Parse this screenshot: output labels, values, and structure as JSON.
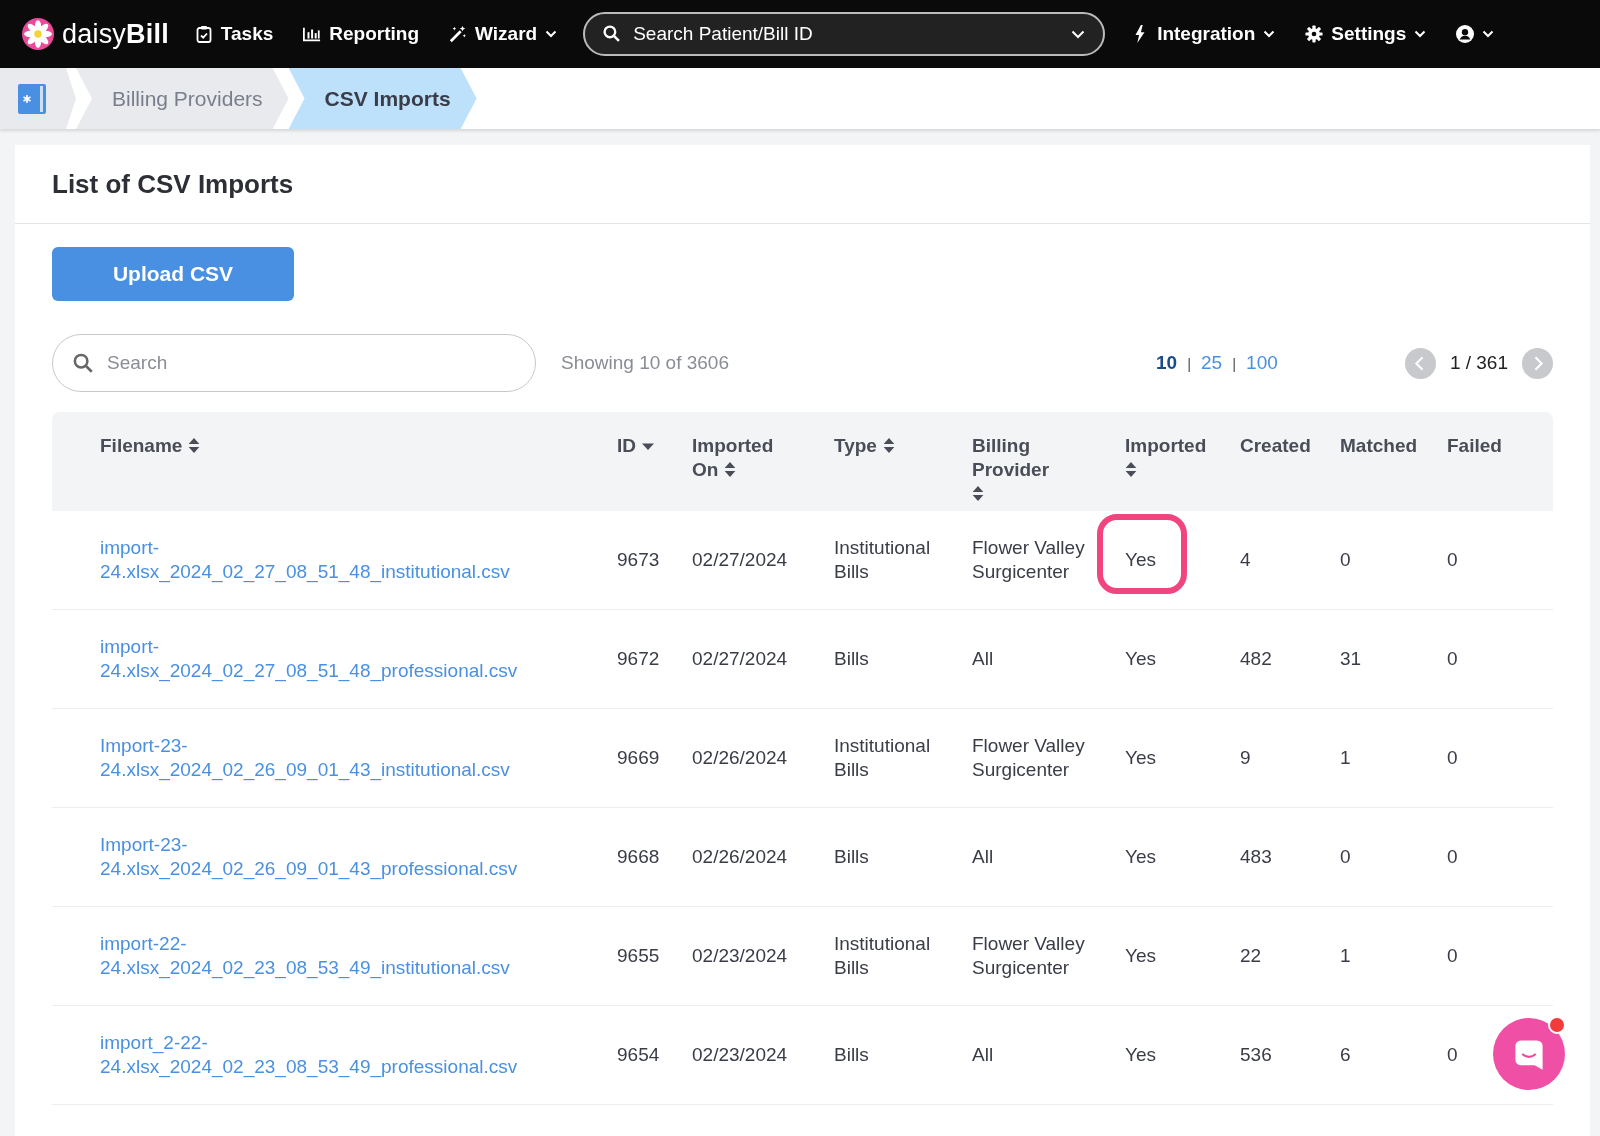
{
  "nav": {
    "logo": "daisy",
    "logo_bold": "Bill",
    "items": [
      {
        "label": "Tasks",
        "caret": false
      },
      {
        "label": "Reporting",
        "caret": false
      },
      {
        "label": "Wizard",
        "caret": true
      }
    ],
    "search": {
      "placeholder": "Search Patient/Bill ID"
    },
    "right_items": [
      {
        "label": "Integration",
        "caret": true
      },
      {
        "label": "Settings",
        "caret": true
      },
      {
        "caret": true
      }
    ]
  },
  "breadcrumbs": [
    {
      "label": "Billing Providers",
      "selected": false
    },
    {
      "label": "CSV Imports",
      "selected": true
    }
  ],
  "page": {
    "title": "List of CSV Imports",
    "upload_button": "Upload CSV",
    "search": {
      "placeholder": "Search"
    },
    "showing": "Showing 10 of 3606",
    "page_sizes": [
      {
        "label": "10",
        "selected": true
      },
      {
        "separator": "|",
        "label": "25",
        "selected": false
      },
      {
        "separator": "|",
        "label": "100",
        "selected": false
      }
    ],
    "pagination": "1 / 361"
  },
  "table": {
    "columns": [
      {
        "label": "Filename",
        "sortable": true,
        "sorted_desc": false
      },
      {
        "label": "ID",
        "sortable": true,
        "sorted_desc": true
      },
      {
        "label": "Imported On",
        "sortable": true,
        "sorted_desc": false
      },
      {
        "label": "Type",
        "sortable": true,
        "sorted_desc": false
      },
      {
        "label": "Billing Provider",
        "sortable": true,
        "sorted_desc": false
      },
      {
        "label": "Imported",
        "sortable": true,
        "sorted_desc": false
      },
      {
        "label": "Created",
        "sortable": false
      },
      {
        "label": "Matched",
        "sortable": false
      },
      {
        "label": "Failed",
        "sortable": false
      }
    ],
    "rows": [
      {
        "filename": "import-24.xlsx_2024_02_27_08_51_48_institutional.csv",
        "id": "9673",
        "imported_on": "02/27/2024",
        "type": "Institutional Bills",
        "billing_provider": "Flower Valley Surgicenter",
        "imported": "Yes",
        "highlighted": true,
        "created": "4",
        "matched": "0",
        "failed": "0"
      },
      {
        "filename": "import-24.xlsx_2024_02_27_08_51_48_professional.csv",
        "id": "9672",
        "imported_on": "02/27/2024",
        "type": "Bills",
        "billing_provider": "All",
        "imported": "Yes",
        "highlighted": false,
        "created": "482",
        "matched": "31",
        "failed": "0"
      },
      {
        "filename": "Import-23-24.xlsx_2024_02_26_09_01_43_institutional.csv",
        "id": "9669",
        "imported_on": "02/26/2024",
        "type": "Institutional Bills",
        "billing_provider": "Flower Valley Surgicenter",
        "imported": "Yes",
        "highlighted": false,
        "created": "9",
        "matched": "1",
        "failed": "0"
      },
      {
        "filename": "Import-23-24.xlsx_2024_02_26_09_01_43_professional.csv",
        "id": "9668",
        "imported_on": "02/26/2024",
        "type": "Bills",
        "billing_provider": "All",
        "imported": "Yes",
        "highlighted": false,
        "created": "483",
        "matched": "0",
        "failed": "0"
      },
      {
        "filename": "import-22-24.xlsx_2024_02_23_08_53_49_institutional.csv",
        "id": "9655",
        "imported_on": "02/23/2024",
        "type": "Institutional Bills",
        "billing_provider": "Flower Valley Surgicenter",
        "imported": "Yes",
        "highlighted": false,
        "created": "22",
        "matched": "1",
        "failed": "0"
      },
      {
        "filename": "import_2-22-24.xlsx_2024_02_23_08_53_49_professional.csv",
        "id": "9654",
        "imported_on": "02/23/2024",
        "type": "Bills",
        "billing_provider": "All",
        "imported": "Yes",
        "highlighted": false,
        "created": "536",
        "matched": "6",
        "failed": "0"
      }
    ]
  },
  "chat": {
    "unread": true
  }
}
